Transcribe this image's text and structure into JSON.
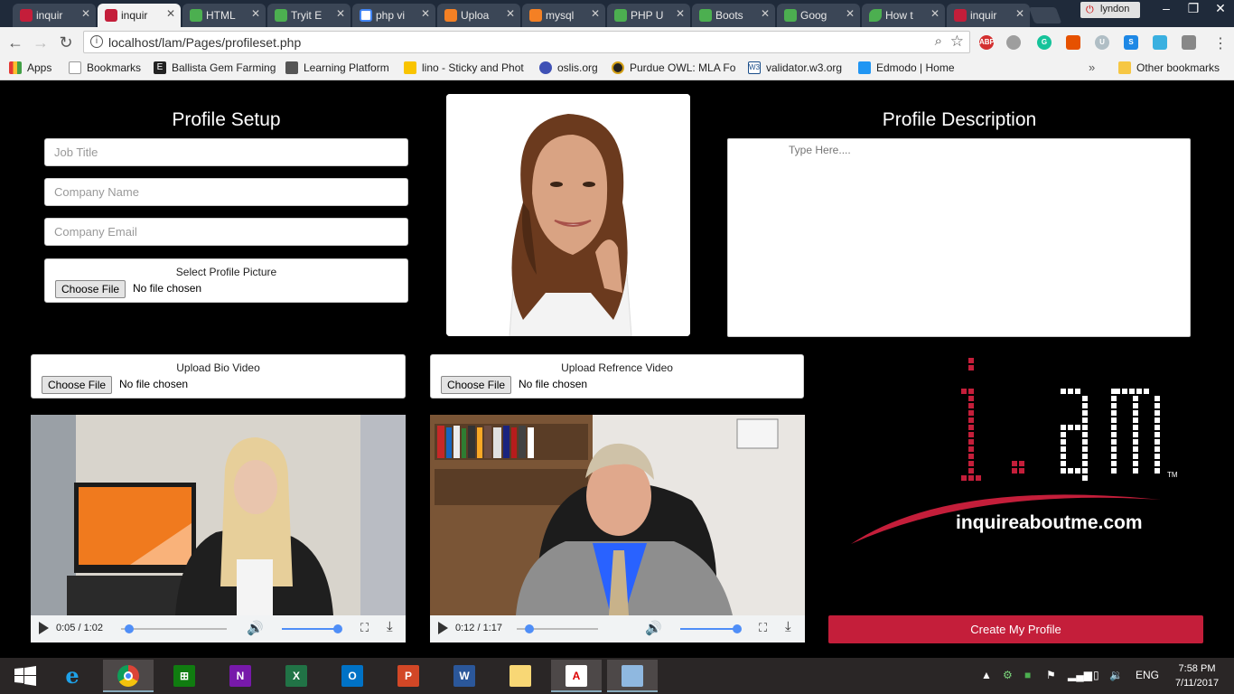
{
  "browser": {
    "tabs": [
      {
        "label": "inquir",
        "favicon": "iam-logo-icon",
        "color": "#c41e3a",
        "active": false
      },
      {
        "label": "inquir",
        "favicon": "iam-logo-icon",
        "color": "#c41e3a",
        "active": true
      },
      {
        "label": "HTML",
        "favicon": "w3-icon",
        "color": "#4caf50",
        "active": false
      },
      {
        "label": "Tryit E",
        "favicon": "w3-icon",
        "color": "#4caf50",
        "active": false
      },
      {
        "label": "php vi",
        "favicon": "google-icon",
        "color": "#ffffff",
        "active": false
      },
      {
        "label": "Uploa",
        "favicon": "stackoverflow-icon",
        "color": "#f48024",
        "active": false
      },
      {
        "label": "mysql",
        "favicon": "stackoverflow-icon",
        "color": "#f48024",
        "active": false
      },
      {
        "label": "PHP U",
        "favicon": "w3-icon",
        "color": "#4caf50",
        "active": false
      },
      {
        "label": "Boots",
        "favicon": "w3-icon",
        "color": "#4caf50",
        "active": false
      },
      {
        "label": "Goog",
        "favicon": "w3-icon",
        "color": "#4caf50",
        "active": false
      },
      {
        "label": "How t",
        "favicon": "leaf-icon",
        "color": "#4caf50",
        "active": false
      },
      {
        "label": "inquir",
        "favicon": "iam-logo-icon",
        "color": "#c41e3a",
        "active": false
      }
    ],
    "user": "lyndon",
    "url": "localhost/lam/Pages/profileset.php",
    "bookmarks": [
      {
        "label": "Apps",
        "icon": "apps-icon"
      },
      {
        "label": "Bookmarks",
        "icon": "page-icon"
      },
      {
        "label": "Ballista Gem Farming",
        "icon": "e-icon"
      },
      {
        "label": "Learning Platform",
        "icon": "cisco-icon"
      },
      {
        "label": "lino - Sticky and Phot",
        "icon": "lino-icon"
      },
      {
        "label": "oslis.org",
        "icon": "oslis-icon"
      },
      {
        "label": "Purdue OWL: MLA Fo",
        "icon": "purdue-icon"
      },
      {
        "label": "validator.w3.org",
        "icon": "w3c-icon"
      },
      {
        "label": "Edmodo | Home",
        "icon": "edmodo-icon"
      }
    ],
    "bookmarks_more": "»",
    "other_bookmarks": "Other bookmarks"
  },
  "profile_setup": {
    "title": "Profile Setup",
    "job_title_placeholder": "Job Title",
    "company_name_placeholder": "Company Name",
    "company_email_placeholder": "Company Email",
    "picture_label": "Select Profile Picture",
    "choose_file": "Choose File",
    "no_file": "No file chosen"
  },
  "profile_description": {
    "title": "Profile Description",
    "placeholder": "Type Here...."
  },
  "bio_video": {
    "label": "Upload Bio Video",
    "choose_file": "Choose File",
    "no_file": "No file chosen",
    "time": "0:05 / 1:02",
    "progress": 0.08,
    "volume": 1.0
  },
  "reference_video": {
    "label": "Upload Refrence Video",
    "choose_file": "Choose File",
    "no_file": "No file chosen",
    "time": "0:12 / 1:17",
    "progress": 0.16,
    "volume": 1.0
  },
  "logo": {
    "wordmark": "inquireaboutme.com",
    "trademark": "TM",
    "accent_color": "#c41e3a"
  },
  "create_button": "Create My Profile",
  "taskbar": {
    "language": "ENG",
    "time": "7:58 PM",
    "date": "7/11/2017",
    "apps": [
      "windows-start-icon",
      "internet-explorer-icon",
      "chrome-icon",
      "store-icon",
      "onenote-icon",
      "excel-icon",
      "outlook-icon",
      "powerpoint-icon",
      "word-icon",
      "file-explorer-icon",
      "acrobat-icon",
      "virtualbox-icon"
    ]
  }
}
